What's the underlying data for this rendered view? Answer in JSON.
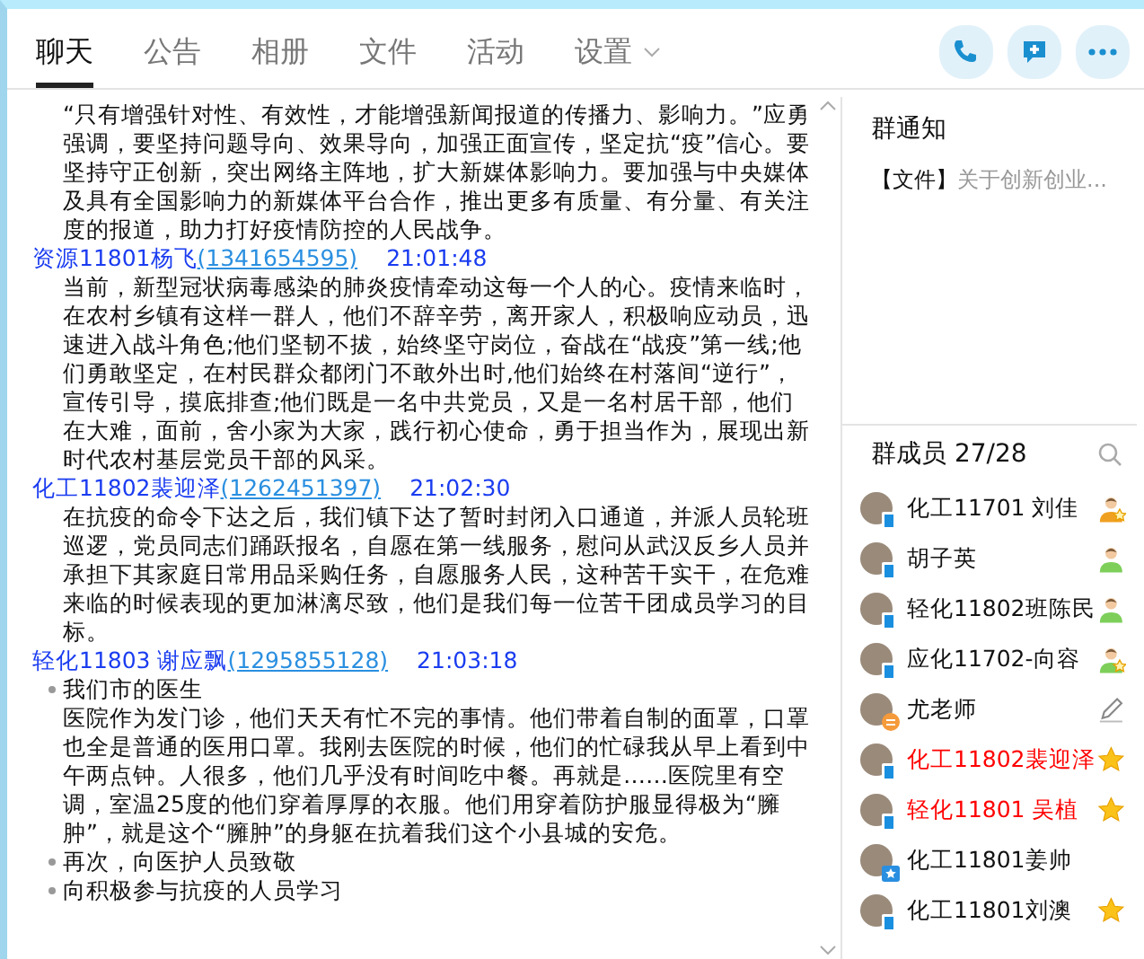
{
  "tabs": [
    {
      "label": "聊天",
      "selected": true,
      "dropdown": false
    },
    {
      "label": "公告",
      "selected": false,
      "dropdown": false
    },
    {
      "label": "相册",
      "selected": false,
      "dropdown": false
    },
    {
      "label": "文件",
      "selected": false,
      "dropdown": false
    },
    {
      "label": "活动",
      "selected": false,
      "dropdown": false
    },
    {
      "label": "设置",
      "selected": false,
      "dropdown": true
    }
  ],
  "messages": [
    {
      "blocks": [
        {
          "kind": "text",
          "text": "“只有增强针对性、有效性，才能增强新闻报道的传播力、影响力。”应勇强调，要坚持问题导向、效果导向，加强正面宣传，坚定抗“疫”信心。要坚持守正创新，突出网络主阵地，扩大新媒体影响力。要加强与中央媒体及具有全国影响力的新媒体平台合作，推出更多有质量、有分量、有关注度的报道，助力打好疫情防控的人民战争。"
        }
      ]
    },
    {
      "sender": {
        "name": "资源11801杨飞",
        "qq": "(1341654595)",
        "time": "21:01:48"
      },
      "blocks": [
        {
          "kind": "text",
          "text": "当前，新型冠状病毒感染的肺炎疫情牵动这每一个人的心。疫情来临时，在农村乡镇有这样一群人，他们不辞辛劳，离开家人，积极响应动员，迅速进入战斗角色;他们坚韧不拔，始终坚守岗位，奋战在“战疫”第一线;他们勇敢坚定，在村民群众都闭门不敢外出时,他们始终在村落间“逆行”，宣传引导，摸底排查;他们既是一名中共党员，又是一名村居干部，他们在大难，面前，舍小家为大家，践行初心使命，勇于担当作为，展现出新时代农村基层党员干部的风采。"
        }
      ]
    },
    {
      "sender": {
        "name": "化工11802裴迎泽",
        "qq": "(1262451397)",
        "time": "21:02:30"
      },
      "blocks": [
        {
          "kind": "text",
          "text": "在抗疫的命令下达之后，我们镇下达了暂时封闭入口通道，并派人员轮班巡逻，党员同志们踊跃报名，自愿在第一线服务，慰问从武汉反乡人员并承担下其家庭日常用品采购任务，自愿服务人民，这种苦干实干，在危难来临的时候表现的更加淋漓尽致，他们是我们每一位苦干团成员学习的目标。"
        }
      ]
    },
    {
      "sender": {
        "name": "轻化11803 谢应飘",
        "qq": "(1295855128)",
        "time": "21:03:18"
      },
      "blocks": [
        {
          "kind": "bullet",
          "text": "我们市的医生"
        },
        {
          "kind": "text",
          "text": "医院作为发门诊，他们天天有忙不完的事情。他们带着自制的面罩，口罩也全是普通的医用口罩。我刚去医院的时候，他们的忙碌我从早上看到中午两点钟。人很多，他们几乎没有时间吃中餐。再就是……医院里有空调，室温25度的他们穿着厚厚的衣服。他们用穿着防护服显得极为“臃肿”，就是这个“臃肿”的身躯在抗着我们这个小县城的安危。"
        },
        {
          "kind": "bullet",
          "text": "再次，向医护人员致敬"
        },
        {
          "kind": "bullet",
          "text": "向积极参与抗疫的人员学习"
        }
      ]
    }
  ],
  "notice": {
    "title": "群通知",
    "tag": "【文件】",
    "text": "关于创新创业..."
  },
  "members_header": {
    "title": "群成员",
    "count": "27/28"
  },
  "members": [
    {
      "name": "化工11701 刘佳",
      "highlight": false,
      "badge": {
        "kind": "phone"
      },
      "role": {
        "kind": "owner"
      }
    },
    {
      "name": "胡子英",
      "highlight": false,
      "badge": {
        "kind": "phone"
      },
      "role": {
        "kind": "member"
      }
    },
    {
      "name": "轻化11802班陈民",
      "highlight": false,
      "badge": {
        "kind": "phone"
      },
      "role": {
        "kind": "member"
      }
    },
    {
      "name": "应化11702-向容",
      "highlight": false,
      "badge": {
        "kind": "phone"
      },
      "role": {
        "kind": "admin"
      }
    },
    {
      "name": "尤老师",
      "highlight": false,
      "badge": {
        "kind": "note"
      },
      "role": {
        "kind": "pencil"
      }
    },
    {
      "name": "化工11802裴迎泽",
      "highlight": true,
      "badge": {
        "kind": "phone"
      },
      "role": {
        "kind": "star"
      }
    },
    {
      "name": "轻化11801 吴植",
      "highlight": true,
      "badge": {
        "kind": "phone"
      },
      "role": {
        "kind": "star"
      }
    },
    {
      "name": "化工11801姜帅",
      "highlight": false,
      "badge": {
        "kind": "starbag"
      }
    },
    {
      "name": "化工11801刘澳",
      "highlight": false,
      "badge": {
        "kind": "phone"
      },
      "role": {
        "kind": "star"
      }
    }
  ]
}
